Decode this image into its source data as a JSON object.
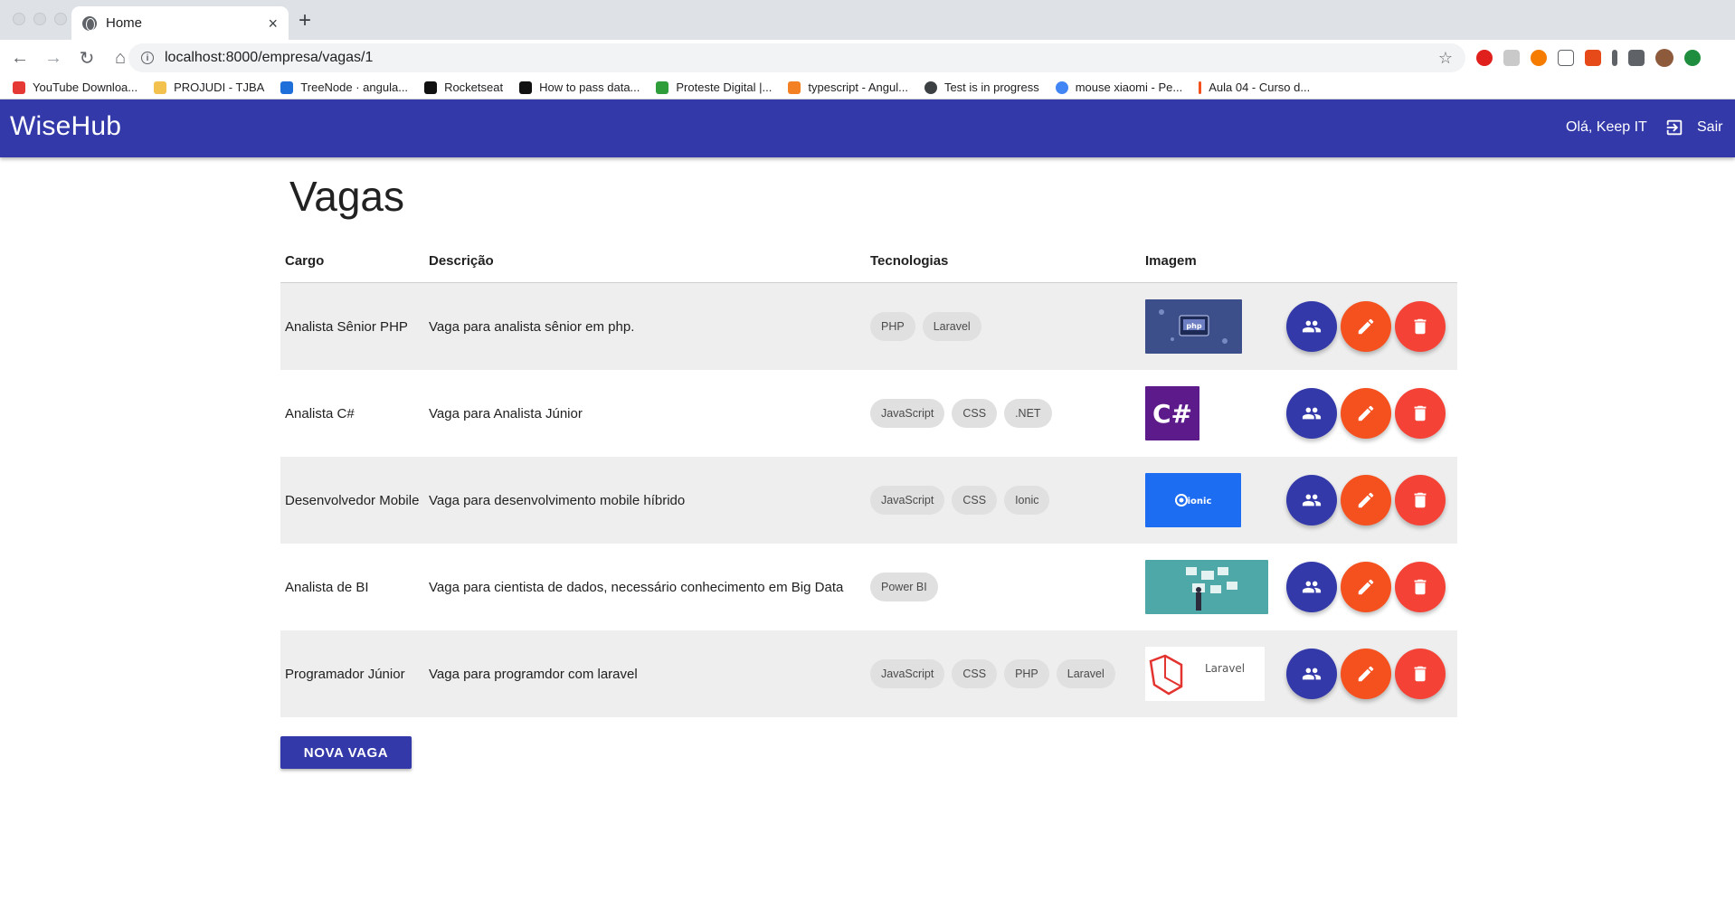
{
  "browser": {
    "tab_title": "Home",
    "tab_close": "×",
    "new_tab": "+",
    "url": "localhost:8000/empresa/vagas/1",
    "bookmarks": [
      {
        "label": "YouTube Downloa...",
        "color": "#e53935"
      },
      {
        "label": "PROJUDI - TJBA",
        "color": "#f2c14e"
      },
      {
        "label": "TreeNode · angula...",
        "color": "#1e6fd9"
      },
      {
        "label": "Rocketseat",
        "color": "#111111"
      },
      {
        "label": "How to pass data...",
        "color": "#111111"
      },
      {
        "label": "Proteste Digital |...",
        "color": "#2e9d3a"
      },
      {
        "label": "typescript - Angul...",
        "color": "#f48024"
      },
      {
        "label": "Test is in progress",
        "color": "#3c4043"
      },
      {
        "label": "mouse xiaomi - Pe...",
        "color": "#4285f4"
      },
      {
        "label": "Aula 04 - Curso d...",
        "color": "#f4511e"
      }
    ]
  },
  "app": {
    "brand": "WiseHub",
    "greeting": "Olá, Keep IT",
    "logout_label": "Sair",
    "primary_color": "#3339a9"
  },
  "page": {
    "title": "Vagas",
    "columns": [
      "Cargo",
      "Descrição",
      "Tecnologias",
      "Imagem"
    ],
    "rows": [
      {
        "cargo": "Analista Sênior PHP",
        "descricao": "Vaga para analista sênior em php.",
        "tecnologias": [
          "PHP",
          "Laravel"
        ],
        "image_text": "php"
      },
      {
        "cargo": "Analista C#",
        "descricao": "Vaga para Analista Júnior",
        "tecnologias": [
          "JavaScript",
          "CSS",
          ".NET"
        ],
        "image_text": "C#"
      },
      {
        "cargo": "Desenvolvedor Mobile",
        "descricao": "Vaga para desenvolvimento mobile híbrido",
        "tecnologias": [
          "JavaScript",
          "CSS",
          "Ionic"
        ],
        "image_text": "ionic"
      },
      {
        "cargo": "Analista de BI",
        "descricao": "Vaga para cientista de dados, necessário conhecimento em Big Data",
        "tecnologias": [
          "Power BI"
        ],
        "image_text": ""
      },
      {
        "cargo": "Programador Júnior",
        "descricao": "Vaga para programdor com laravel",
        "tecnologias": [
          "JavaScript",
          "CSS",
          "PHP",
          "Laravel"
        ],
        "image_text": "Laravel"
      }
    ],
    "new_button": "NOVA VAGA"
  }
}
